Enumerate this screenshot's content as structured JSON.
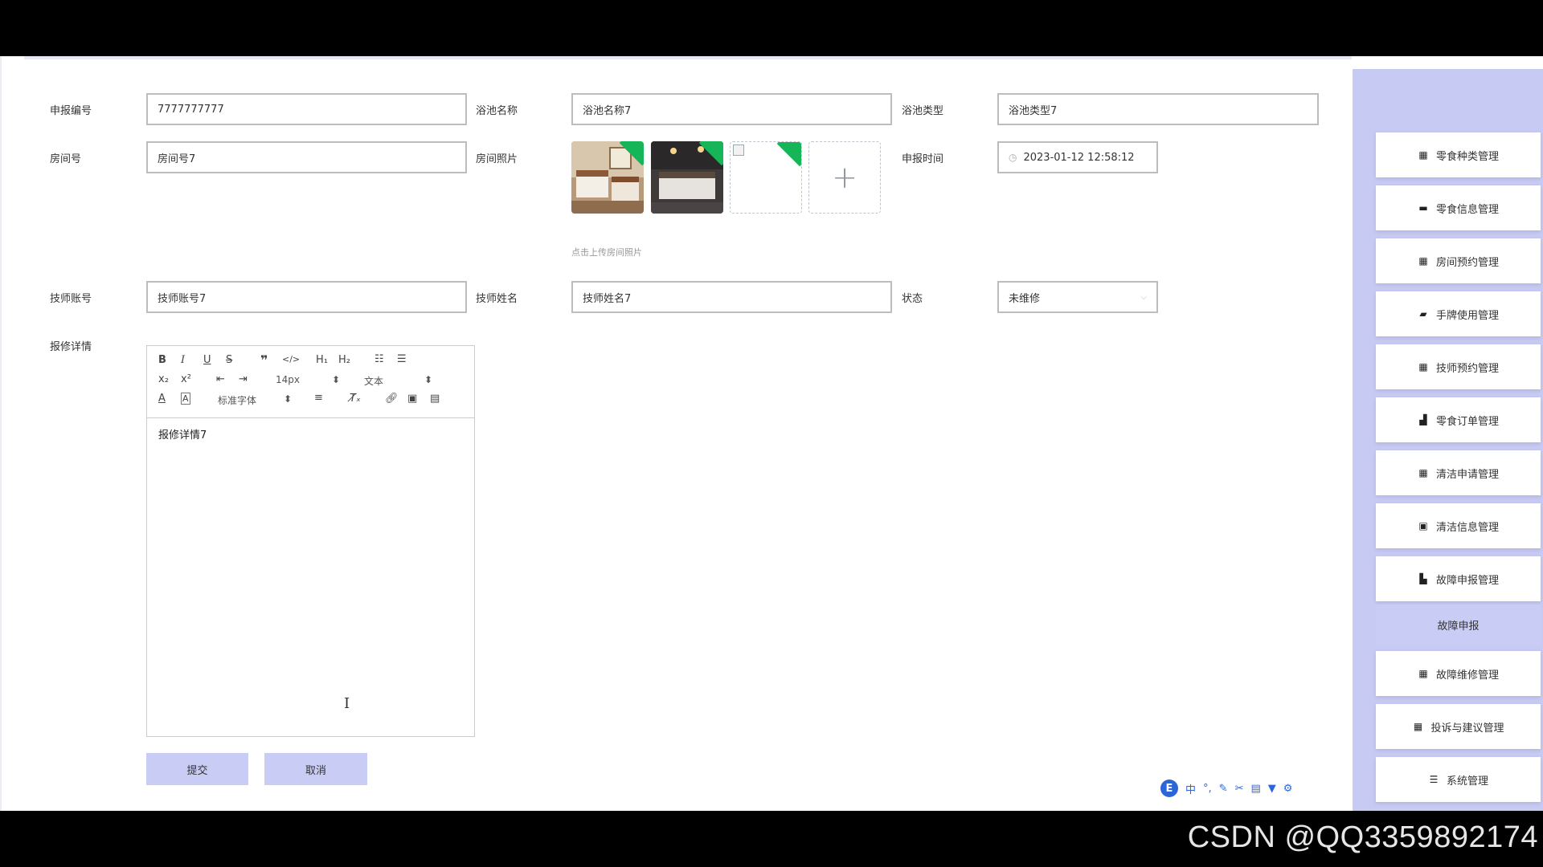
{
  "form": {
    "report_no_label": "申报编号",
    "report_no_value": "7777777777",
    "pool_name_label": "浴池名称",
    "pool_name_value": "浴池名称7",
    "pool_type_label": "浴池类型",
    "pool_type_value": "浴池类型7",
    "room_no_label": "房间号",
    "room_no_value": "房间号7",
    "room_photo_label": "房间照片",
    "room_photo_hint": "点击上传房间照片",
    "report_time_label": "申报时间",
    "report_time_value": "2023-01-12 12:58:12",
    "tech_account_label": "技师账号",
    "tech_account_value": "技师账号7",
    "tech_name_label": "技师姓名",
    "tech_name_value": "技师姓名7",
    "status_label": "状态",
    "status_value": "未维修",
    "detail_label": "报修详情"
  },
  "editor": {
    "font_size": "14px",
    "header_select": "文本",
    "font_family": "标准字体",
    "content": "报修详情7"
  },
  "buttons": {
    "submit": "提交",
    "cancel": "取消"
  },
  "sidebar": {
    "items": [
      {
        "label": "零食种类管理",
        "icon": "grid-icon"
      },
      {
        "label": "零食信息管理",
        "icon": "monitor-icon"
      },
      {
        "label": "房间预约管理",
        "icon": "grid-icon"
      },
      {
        "label": "手牌使用管理",
        "icon": "chat-icon"
      },
      {
        "label": "技师预约管理",
        "icon": "grid-icon"
      },
      {
        "label": "零食订单管理",
        "icon": "bar-chart-icon"
      },
      {
        "label": "清洁申请管理",
        "icon": "grid-icon"
      },
      {
        "label": "清洁信息管理",
        "icon": "briefcase-icon"
      },
      {
        "label": "故障申报管理",
        "icon": "folder-icon"
      },
      {
        "label": "故障维修管理",
        "icon": "grid-icon"
      },
      {
        "label": "投诉与建议管理",
        "icon": "grid-icon"
      },
      {
        "label": "系统管理",
        "icon": "list-icon"
      }
    ],
    "sub_item": "故障申报"
  },
  "watermark": "CSDN @QQ3359892174",
  "ime_label": "中"
}
